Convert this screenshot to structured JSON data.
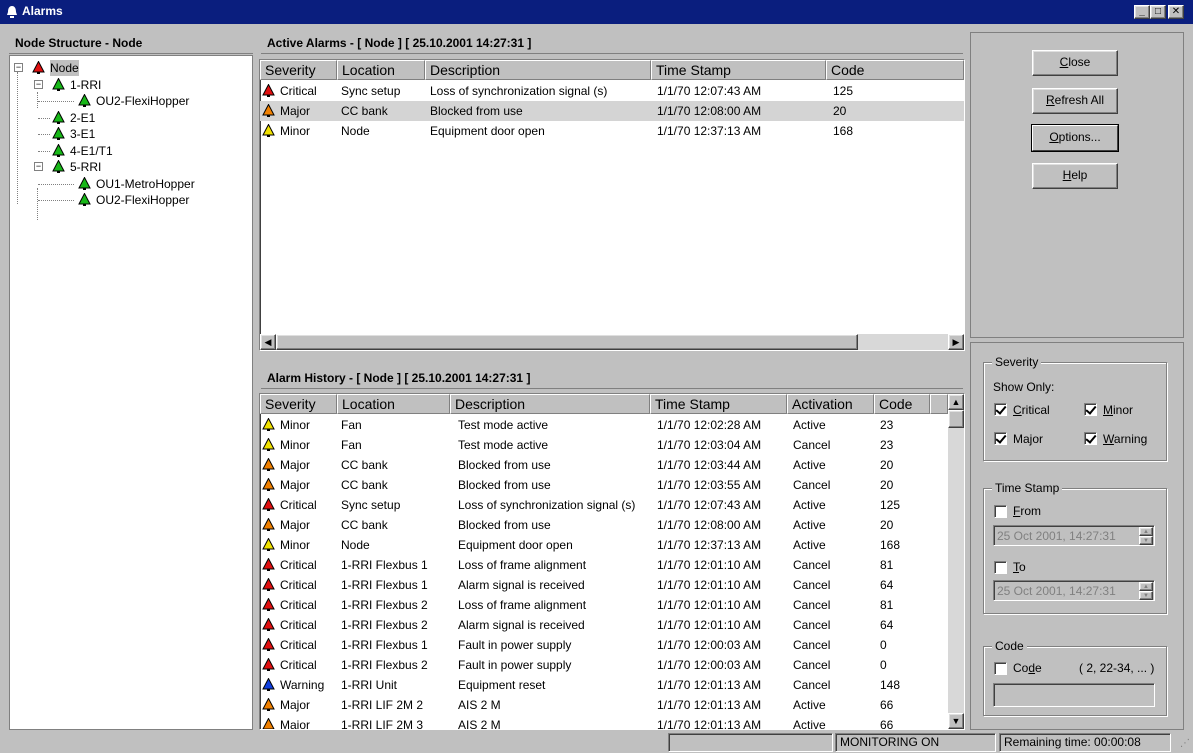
{
  "window": {
    "title": "Alarms"
  },
  "colors": {
    "critical": "#e01010",
    "major": "#f08000",
    "minor": "#f0e000",
    "warning": "#1040e0",
    "ok": "#18b818",
    "titlebar": "#0a1e7e"
  },
  "tree": {
    "header": "Node Structure - Node",
    "nodes": [
      {
        "label": "Node",
        "color": "#e01010",
        "level": 0,
        "expander": "−"
      },
      {
        "label": "1-RRI",
        "color": "#18b818",
        "level": 1,
        "expander": "−"
      },
      {
        "label": "OU2-FlexiHopper",
        "color": "#18b818",
        "level": 2,
        "expander": ""
      },
      {
        "label": "2-E1",
        "color": "#18b818",
        "level": 1,
        "expander": ""
      },
      {
        "label": "3-E1",
        "color": "#18b818",
        "level": 1,
        "expander": ""
      },
      {
        "label": "4-E1/T1",
        "color": "#18b818",
        "level": 1,
        "expander": ""
      },
      {
        "label": "5-RRI",
        "color": "#18b818",
        "level": 1,
        "expander": "−"
      },
      {
        "label": "OU1-MetroHopper",
        "color": "#18b818",
        "level": 2,
        "expander": ""
      },
      {
        "label": "OU2-FlexiHopper",
        "color": "#18b818",
        "level": 2,
        "expander": ""
      }
    ]
  },
  "active_alarms": {
    "header": "Active Alarms - [ Node ] [ 25.10.2001 14:27:31 ]",
    "columns": [
      "Severity",
      "Location",
      "Description",
      "Time Stamp",
      "Code"
    ],
    "rows": [
      {
        "severity": "Critical",
        "location": "Sync setup",
        "description": "Loss of synchronization signal (s)",
        "timestamp": "1/1/70 12:07:43 AM",
        "code": "125",
        "selected": false
      },
      {
        "severity": "Major",
        "location": "CC bank",
        "description": "Blocked from use",
        "timestamp": "1/1/70 12:08:00 AM",
        "code": "20",
        "selected": true
      },
      {
        "severity": "Minor",
        "location": "Node",
        "description": "Equipment door open",
        "timestamp": "1/1/70 12:37:13 AM",
        "code": "168",
        "selected": false
      }
    ]
  },
  "alarm_history": {
    "header": "Alarm History - [ Node ] [ 25.10.2001 14:27:31 ]",
    "columns": [
      "Severity",
      "Location",
      "Description",
      "Time Stamp",
      "Activation",
      "Code"
    ],
    "rows": [
      {
        "severity": "Minor",
        "location": "Fan",
        "description": "Test mode active",
        "timestamp": "1/1/70 12:02:28 AM",
        "activation": "Active",
        "code": "23"
      },
      {
        "severity": "Minor",
        "location": "Fan",
        "description": "Test mode active",
        "timestamp": "1/1/70 12:03:04 AM",
        "activation": "Cancel",
        "code": "23"
      },
      {
        "severity": "Major",
        "location": "CC bank",
        "description": "Blocked from use",
        "timestamp": "1/1/70 12:03:44 AM",
        "activation": "Active",
        "code": "20"
      },
      {
        "severity": "Major",
        "location": "CC bank",
        "description": "Blocked from use",
        "timestamp": "1/1/70 12:03:55 AM",
        "activation": "Cancel",
        "code": "20"
      },
      {
        "severity": "Critical",
        "location": "Sync setup",
        "description": "Loss of synchronization signal (s)",
        "timestamp": "1/1/70 12:07:43 AM",
        "activation": "Active",
        "code": "125"
      },
      {
        "severity": "Major",
        "location": "CC bank",
        "description": "Blocked from use",
        "timestamp": "1/1/70 12:08:00 AM",
        "activation": "Active",
        "code": "20"
      },
      {
        "severity": "Minor",
        "location": "Node",
        "description": "Equipment door open",
        "timestamp": "1/1/70 12:37:13 AM",
        "activation": "Active",
        "code": "168"
      },
      {
        "severity": "Critical",
        "location": "1-RRI Flexbus 1",
        "description": "Loss of frame alignment",
        "timestamp": "1/1/70 12:01:10 AM",
        "activation": "Cancel",
        "code": "81"
      },
      {
        "severity": "Critical",
        "location": "1-RRI Flexbus 1",
        "description": "Alarm signal is received",
        "timestamp": "1/1/70 12:01:10 AM",
        "activation": "Cancel",
        "code": "64"
      },
      {
        "severity": "Critical",
        "location": "1-RRI Flexbus 2",
        "description": "Loss of frame alignment",
        "timestamp": "1/1/70 12:01:10 AM",
        "activation": "Cancel",
        "code": "81"
      },
      {
        "severity": "Critical",
        "location": "1-RRI Flexbus 2",
        "description": "Alarm signal is received",
        "timestamp": "1/1/70 12:01:10 AM",
        "activation": "Cancel",
        "code": "64"
      },
      {
        "severity": "Critical",
        "location": "1-RRI Flexbus 1",
        "description": "Fault in power supply",
        "timestamp": "1/1/70 12:00:03 AM",
        "activation": "Cancel",
        "code": "0"
      },
      {
        "severity": "Critical",
        "location": "1-RRI Flexbus 2",
        "description": "Fault in power supply",
        "timestamp": "1/1/70 12:00:03 AM",
        "activation": "Cancel",
        "code": "0"
      },
      {
        "severity": "Warning",
        "location": "1-RRI Unit",
        "description": "Equipment reset",
        "timestamp": "1/1/70 12:01:13 AM",
        "activation": "Cancel",
        "code": "148"
      },
      {
        "severity": "Major",
        "location": "1-RRI LIF 2M 2",
        "description": "AIS 2 M",
        "timestamp": "1/1/70 12:01:13 AM",
        "activation": "Active",
        "code": "66"
      },
      {
        "severity": "Major",
        "location": "1-RRI LIF 2M 3",
        "description": "AIS 2 M",
        "timestamp": "1/1/70 12:01:13 AM",
        "activation": "Active",
        "code": "66"
      }
    ]
  },
  "buttons": {
    "close": {
      "label": "Close",
      "mnemonic": "C",
      "rest": "lose"
    },
    "refresh": {
      "label": "Refresh All",
      "mnemonic": "R",
      "rest": "efresh All"
    },
    "options": {
      "label": "Options...",
      "mnemonic": "O",
      "rest": "ptions..."
    },
    "help": {
      "label": "Help",
      "mnemonic": "H",
      "rest": "elp"
    }
  },
  "severity_filter": {
    "title": "Severity",
    "show_only": "Show Only:",
    "critical": {
      "label": "Critical",
      "mnemonic": "C",
      "rest": "ritical",
      "checked": true
    },
    "minor": {
      "label": "Minor",
      "mnemonic": "M",
      "rest": "inor",
      "checked": true
    },
    "major": {
      "label": "Major",
      "pre": "Ma",
      "mnemonic": "j",
      "rest": "or",
      "checked": true
    },
    "warning": {
      "label": "Warning",
      "mnemonic": "W",
      "rest": "arning",
      "checked": true
    }
  },
  "timestamp_filter": {
    "title": "Time Stamp",
    "from": {
      "label": "From",
      "mnemonic": "F",
      "rest": "rom",
      "checked": false,
      "value": "25 Oct 2001, 14:27:31"
    },
    "to": {
      "label": "To",
      "mnemonic": "T",
      "rest": "o",
      "checked": false,
      "value": "25 Oct 2001, 14:27:31"
    }
  },
  "code_filter": {
    "title": "Code",
    "label": "Code",
    "pre": "Co",
    "mnemonic": "d",
    "rest": "e",
    "hint": "( 2, 22-34, ... )",
    "checked": false,
    "value": ""
  },
  "status": {
    "monitoring": "MONITORING ON",
    "remaining": "Remaining time: 00:00:08"
  }
}
